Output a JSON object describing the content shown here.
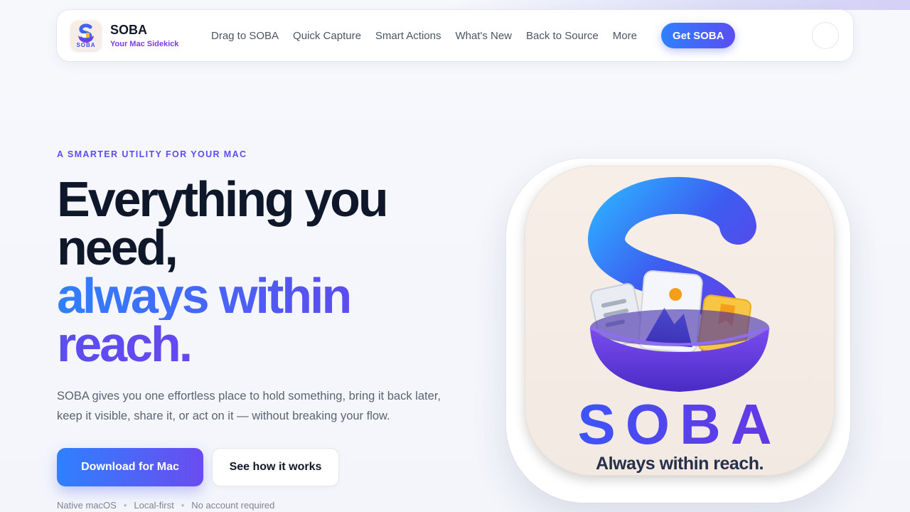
{
  "brand": {
    "name": "SOBA",
    "tagline": "Your Mac Sidekick",
    "logo_text": "SOBA"
  },
  "nav": {
    "links": [
      "Drag to SOBA",
      "Quick Capture",
      "Smart Actions",
      "What's New",
      "Back to Source"
    ],
    "more_label": "More",
    "cta_label": "Get SOBA"
  },
  "hero": {
    "eyebrow": "A SMARTER UTILITY FOR YOUR MAC",
    "headline_line1": "Everything you",
    "headline_line2": "need,",
    "headline_line3": "always within",
    "headline_line4": "reach.",
    "lede": "SOBA gives you one effortless place to hold something, bring it back later, keep it visible, share it, or act on it — without breaking your flow.",
    "primary_button": "Download for Mac",
    "secondary_button": "See how it works",
    "badges": [
      "Native macOS",
      "Local-first",
      "No account required"
    ],
    "badge_separator": "•"
  },
  "app_icon": {
    "wordmark": "SOBA",
    "slogan": "Always within reach."
  },
  "colors": {
    "accent_blue": "#2f80ff",
    "accent_purple": "#5b4ef0",
    "brand_violet": "#7c3aed",
    "heading": "#0f172a"
  }
}
